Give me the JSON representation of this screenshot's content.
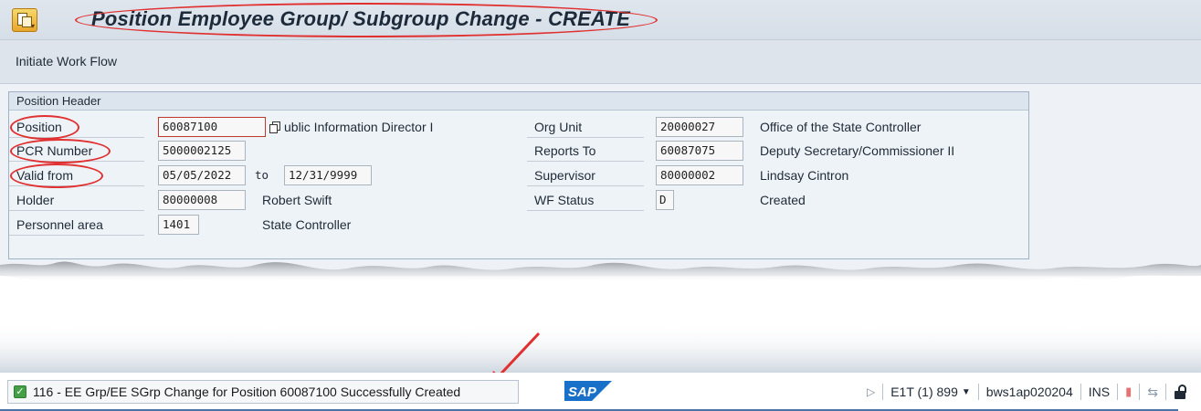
{
  "title_bar": {
    "title": "Position Employee Group/ Subgroup Change - CREATE"
  },
  "toolbar": {
    "initiate_work_flow": "Initiate Work Flow"
  },
  "position_header": {
    "group_title": "Position Header",
    "position": {
      "label": "Position",
      "value": "60087100",
      "description": "ublic Information Director I"
    },
    "pcr_number": {
      "label": "PCR Number",
      "value": "5000002125"
    },
    "valid_from": {
      "label": "Valid from",
      "value": "05/05/2022",
      "to_label": "to",
      "to_value": "12/31/9999"
    },
    "holder": {
      "label": "Holder",
      "value": "80000008",
      "description": "Robert Swift"
    },
    "personnel_area": {
      "label": "Personnel area",
      "value": "1401",
      "description": "State Controller"
    },
    "org_unit": {
      "label": "Org Unit",
      "value": "20000027",
      "description": "Office of the State Controller"
    },
    "reports_to": {
      "label": "Reports To",
      "value": "60087075",
      "description": "Deputy Secretary/Commissioner II"
    },
    "supervisor": {
      "label": "Supervisor",
      "value": "80000002",
      "description": "Lindsay Cintron"
    },
    "wf_status": {
      "label": "WF Status",
      "value": "D",
      "description": "Created"
    }
  },
  "status_bar": {
    "message": "116 - EE Grp/EE SGrp Change for Position 60087100 Successfully Created",
    "sap_logo": "SAP",
    "system": "E1T (1) 899",
    "server": "bws1ap020204",
    "mode": "INS"
  },
  "colors": {
    "annotation_red": "#e03030",
    "title_bar_bg": "#dfe6ee",
    "group_border": "#9fb1c4",
    "sap_blue": "#1870c8"
  }
}
